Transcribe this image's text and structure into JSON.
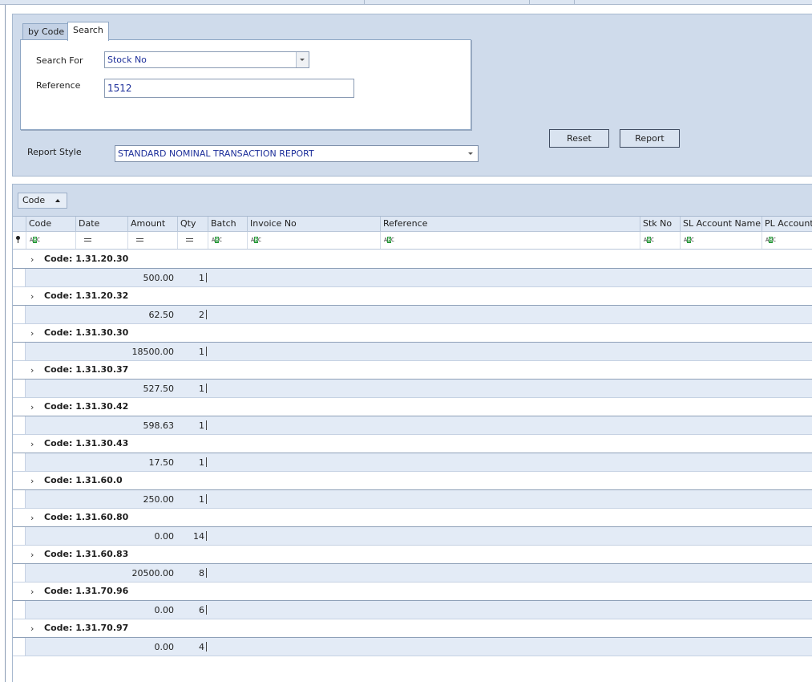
{
  "search_panel": {
    "tabs": [
      {
        "label": "by Code"
      },
      {
        "label": "Search"
      }
    ],
    "search_for_label": "Search For",
    "search_for_value": "Stock No",
    "reference_label": "Reference",
    "reference_value": "1512",
    "report_style_label": "Report Style",
    "report_style_value": "STANDARD NOMINAL TRANSACTION REPORT",
    "reset_label": "Reset",
    "report_label": "Report"
  },
  "grid": {
    "group_by": "Code",
    "columns": [
      "Code",
      "Date",
      "Amount",
      "Qty",
      "Batch",
      "Invoice No",
      "Reference",
      "Stk No",
      "SL Account Name",
      "PL Account N"
    ],
    "groups": [
      {
        "label": "Code: 1.31.20.30",
        "amount": "500.00",
        "qty": "1"
      },
      {
        "label": "Code: 1.31.20.32",
        "amount": "62.50",
        "qty": "2"
      },
      {
        "label": "Code: 1.31.30.30",
        "amount": "18500.00",
        "qty": "1"
      },
      {
        "label": "Code: 1.31.30.37",
        "amount": "527.50",
        "qty": "1"
      },
      {
        "label": "Code: 1.31.30.42",
        "amount": "598.63",
        "qty": "1"
      },
      {
        "label": "Code: 1.31.30.43",
        "amount": "17.50",
        "qty": "1"
      },
      {
        "label": "Code: 1.31.60.0",
        "amount": "250.00",
        "qty": "1"
      },
      {
        "label": "Code: 1.31.60.80",
        "amount": "0.00",
        "qty": "14"
      },
      {
        "label": "Code: 1.31.60.83",
        "amount": "20500.00",
        "qty": "8"
      },
      {
        "label": "Code: 1.31.70.96",
        "amount": "0.00",
        "qty": "6"
      },
      {
        "label": "Code: 1.31.70.97",
        "amount": "0.00",
        "qty": "4"
      }
    ]
  },
  "icons": {
    "combo_arrow": "chevron-down-icon",
    "sort": "sort-ascending-icon",
    "expand": "chevron-right-icon",
    "text_filter": "abc-filter-icon",
    "equals_filter": "equals-filter-icon",
    "pin": "pin-icon"
  }
}
